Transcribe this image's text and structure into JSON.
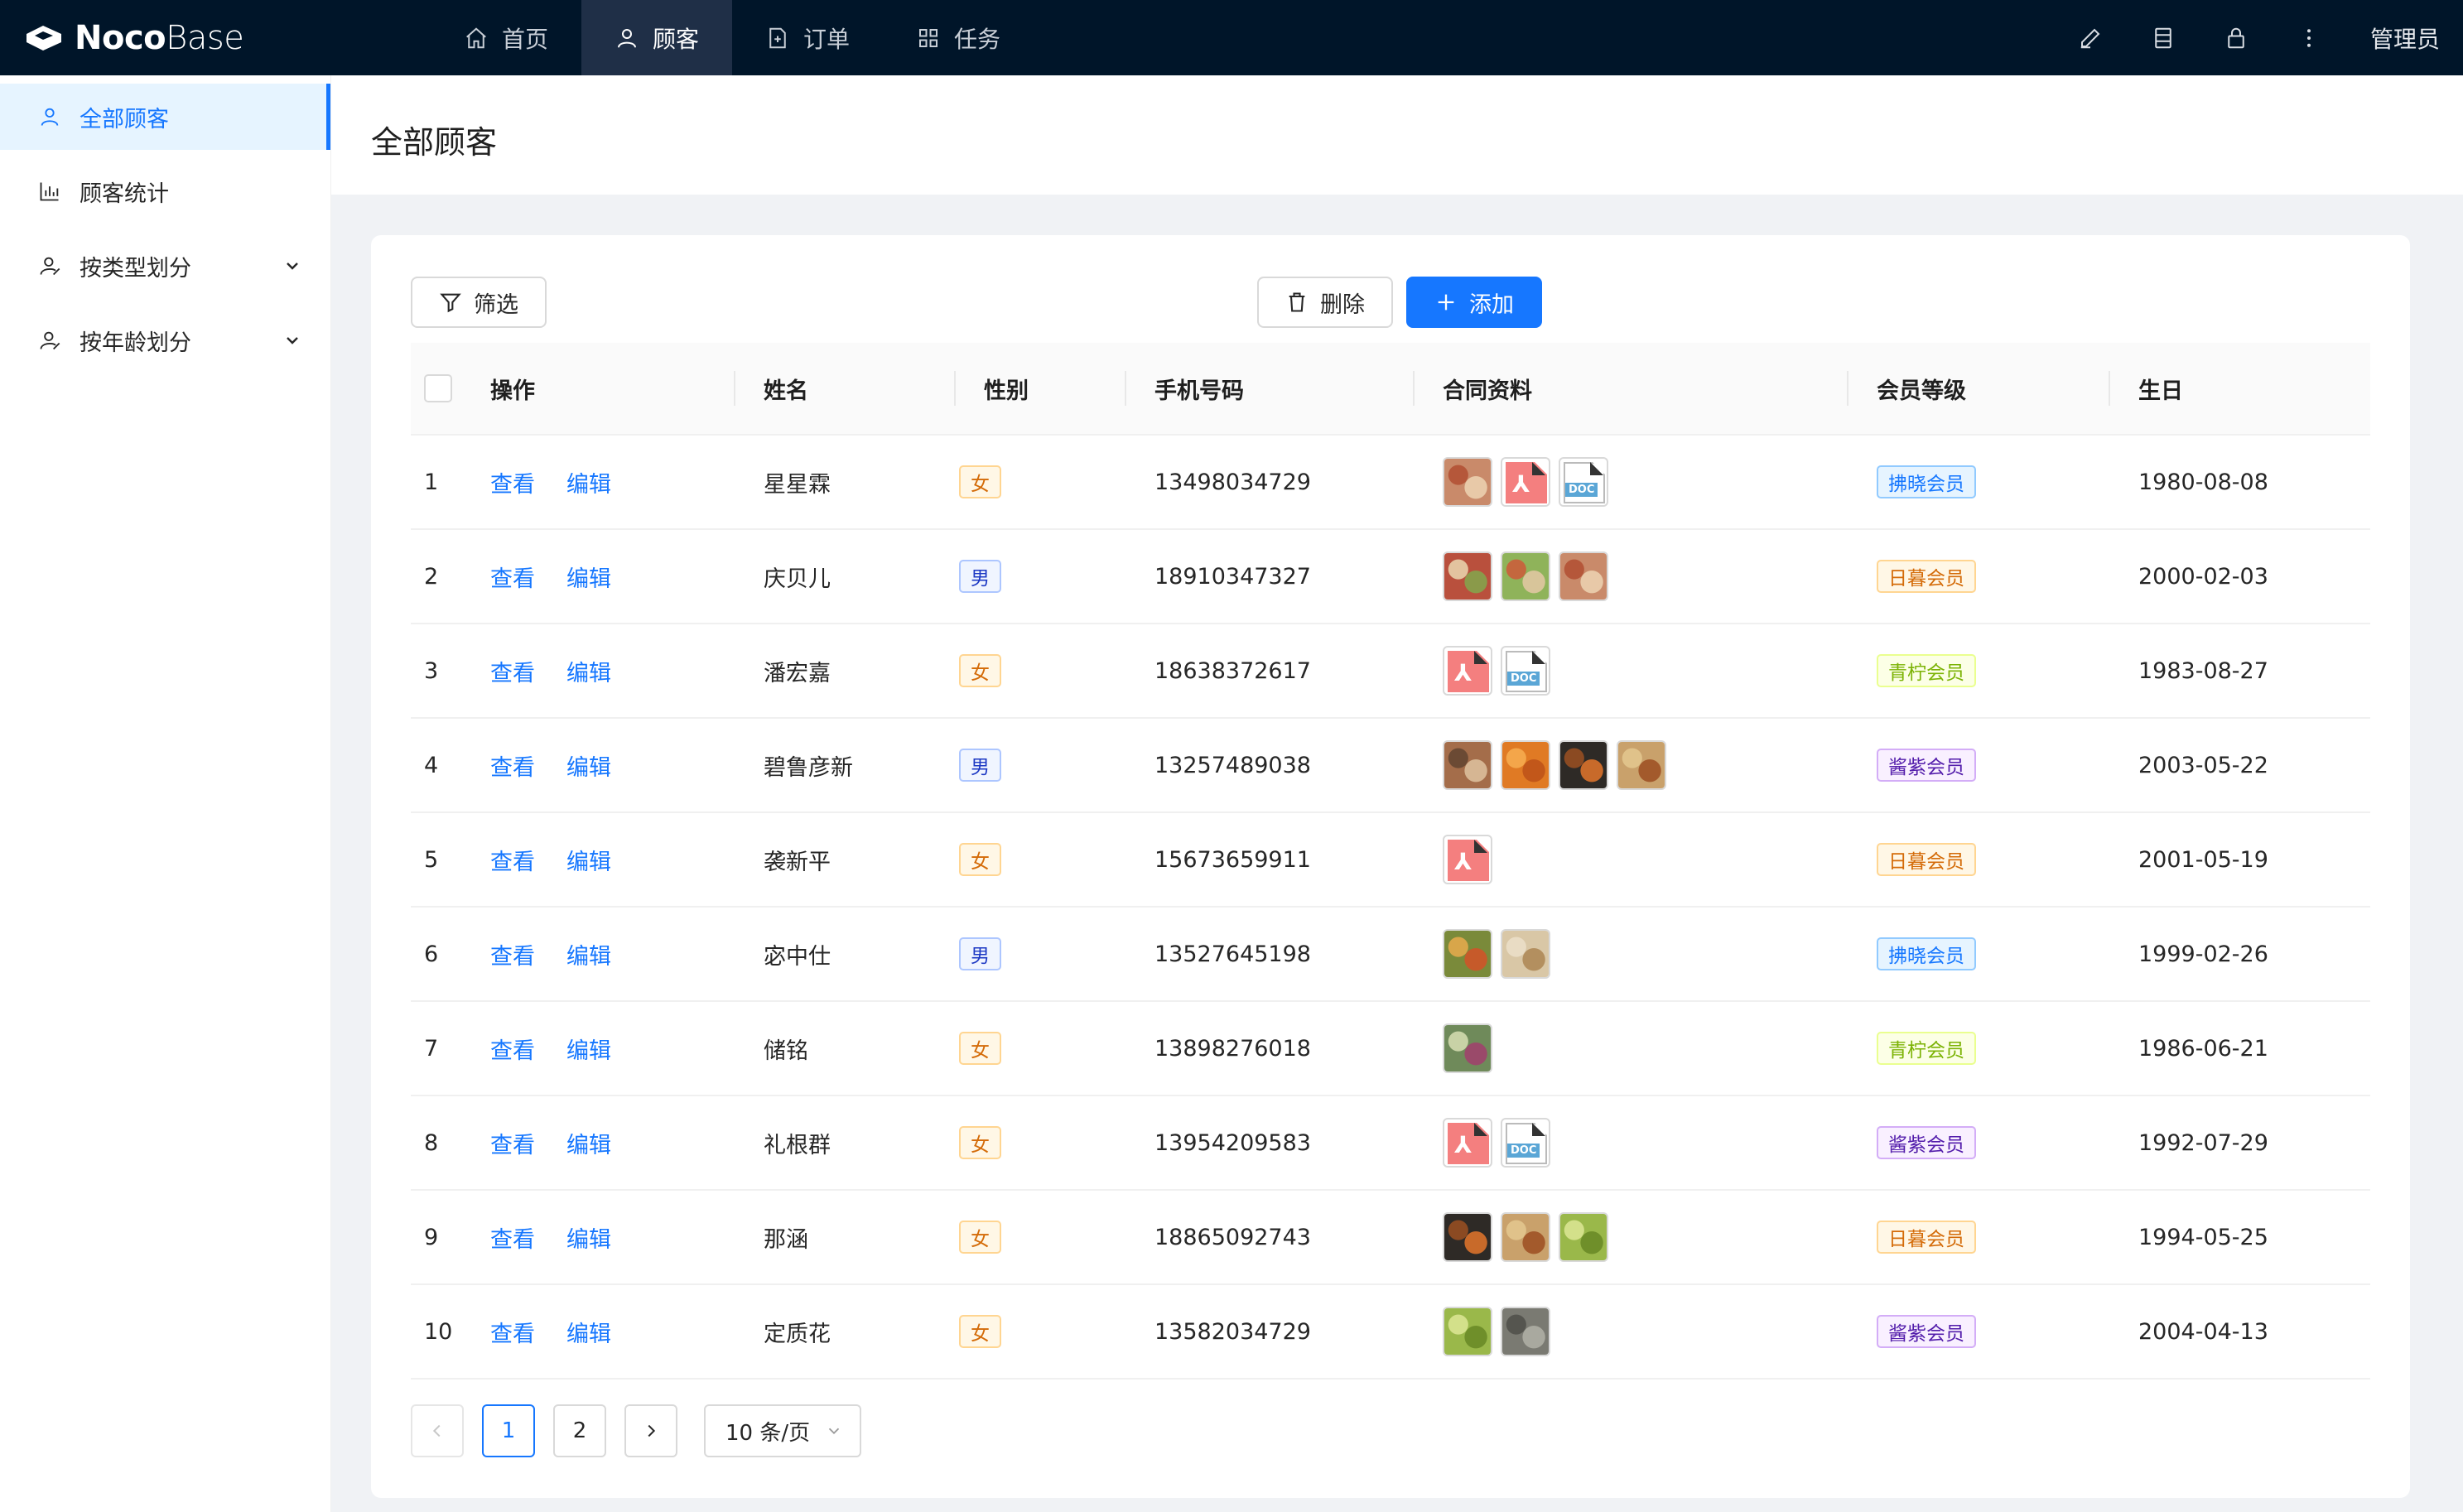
{
  "app": {
    "logo_bold": "Noco",
    "logo_light": "Base",
    "nav": [
      {
        "label": "首页",
        "icon": "home-icon"
      },
      {
        "label": "顾客",
        "icon": "customer-icon",
        "active": true
      },
      {
        "label": "订单",
        "icon": "file-icon"
      },
      {
        "label": "任务",
        "icon": "apps-icon"
      }
    ],
    "user": "管理员"
  },
  "sidebar": {
    "items": [
      {
        "label": "全部顾客",
        "icon": "user-icon",
        "active": true
      },
      {
        "label": "顾客统计",
        "icon": "bar-chart-icon"
      },
      {
        "label": "按类型划分",
        "icon": "user-split-icon",
        "expandable": true
      },
      {
        "label": "按年龄划分",
        "icon": "user-split-icon",
        "expandable": true
      }
    ]
  },
  "page": {
    "title": "全部顾客"
  },
  "toolbar": {
    "filter_label": "筛选",
    "delete_label": "删除",
    "add_label": "添加"
  },
  "table": {
    "columns": [
      "操作",
      "姓名",
      "性别",
      "手机号码",
      "合同资料",
      "会员等级",
      "生日"
    ],
    "view_label": "查看",
    "edit_label": "编辑",
    "rows": [
      {
        "index": "1",
        "name": "星星霖",
        "gender": "女",
        "phone": "13498034729",
        "files": [
          "img:food1",
          "pdf",
          "doc"
        ],
        "level": "拂晓会员",
        "birthday": "1980-08-08"
      },
      {
        "index": "2",
        "name": "庆贝儿",
        "gender": "男",
        "phone": "18910347327",
        "files": [
          "img:food2",
          "img:food3",
          "img:food1"
        ],
        "level": "日暮会员",
        "birthday": "2000-02-03"
      },
      {
        "index": "3",
        "name": "潘宏嘉",
        "gender": "女",
        "phone": "18638372617",
        "files": [
          "pdf",
          "doc"
        ],
        "level": "青柠会员",
        "birthday": "1983-08-27"
      },
      {
        "index": "4",
        "name": "碧鲁彦新",
        "gender": "男",
        "phone": "13257489038",
        "files": [
          "img:market",
          "img:orange",
          "img:fruit-dark",
          "img:fruit-bowl"
        ],
        "level": "酱紫会员",
        "birthday": "2003-05-22"
      },
      {
        "index": "5",
        "name": "袭新平",
        "gender": "女",
        "phone": "15673659911",
        "files": [
          "pdf"
        ],
        "level": "日暮会员",
        "birthday": "2001-05-19"
      },
      {
        "index": "6",
        "name": "宓中仕",
        "gender": "男",
        "phone": "13527645198",
        "files": [
          "img:veg",
          "img:jars"
        ],
        "level": "拂晓会员",
        "birthday": "1999-02-26"
      },
      {
        "index": "7",
        "name": "储铭",
        "gender": "女",
        "phone": "13898276018",
        "files": [
          "img:artichoke"
        ],
        "level": "青柠会员",
        "birthday": "1986-06-21"
      },
      {
        "index": "8",
        "name": "礼根群",
        "gender": "女",
        "phone": "13954209583",
        "files": [
          "pdf",
          "doc"
        ],
        "level": "酱紫会员",
        "birthday": "1992-07-29"
      },
      {
        "index": "9",
        "name": "那涵",
        "gender": "女",
        "phone": "18865092743",
        "files": [
          "img:fruit-dark",
          "img:fruit-bowl",
          "img:grapes"
        ],
        "level": "日暮会员",
        "birthday": "1994-05-25"
      },
      {
        "index": "10",
        "name": "定质花",
        "gender": "女",
        "phone": "13582034729",
        "files": [
          "img:grapes",
          "img:store"
        ],
        "level": "酱紫会员",
        "birthday": "2004-04-13"
      }
    ]
  },
  "pagination": {
    "pages": [
      "1",
      "2"
    ],
    "current": "1",
    "page_size": "10 条/页"
  },
  "colors": {
    "primary": "#1677ff",
    "topbar": "#001529",
    "tag_female": {
      "text": "#d46b08",
      "bg": "#fff7e6",
      "border": "#ffd591"
    },
    "tag_male": {
      "text": "#1d39c4",
      "bg": "#f0f5ff",
      "border": "#adc6ff"
    },
    "level_拂晓会员": {
      "text": "#1677ff",
      "bg": "#e6f4ff",
      "border": "#91caff"
    },
    "level_日暮会员": {
      "text": "#d46b08",
      "bg": "#fff7e6",
      "border": "#ffd591"
    },
    "level_青柠会员": {
      "text": "#7cb305",
      "bg": "#fcffe6",
      "border": "#eaff8f"
    },
    "level_酱紫会员": {
      "text": "#531dab",
      "bg": "#f9f0ff",
      "border": "#d3adf7"
    }
  }
}
